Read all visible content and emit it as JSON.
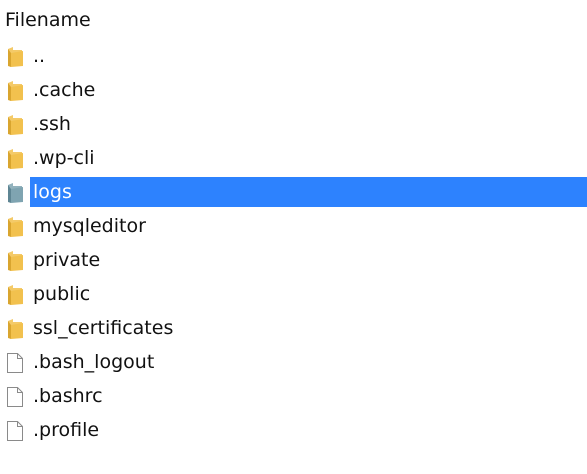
{
  "header": {
    "filename_label": "Filename"
  },
  "colors": {
    "selection": "#2d82fe",
    "folder": "#f2c14e",
    "folder_selected": "#7fa4b1",
    "file_outline": "#8a8a8a"
  },
  "files": [
    {
      "name": "..",
      "type": "folder",
      "icon": "folder-icon",
      "selected": false
    },
    {
      "name": ".cache",
      "type": "folder",
      "icon": "folder-icon",
      "selected": false
    },
    {
      "name": ".ssh",
      "type": "folder",
      "icon": "folder-icon",
      "selected": false
    },
    {
      "name": ".wp-cli",
      "type": "folder",
      "icon": "folder-icon",
      "selected": false
    },
    {
      "name": "logs",
      "type": "folder",
      "icon": "folder-icon",
      "selected": true
    },
    {
      "name": "mysqleditor",
      "type": "folder",
      "icon": "folder-icon",
      "selected": false
    },
    {
      "name": "private",
      "type": "folder",
      "icon": "folder-icon",
      "selected": false
    },
    {
      "name": "public",
      "type": "folder",
      "icon": "folder-icon",
      "selected": false
    },
    {
      "name": "ssl_certificates",
      "type": "folder",
      "icon": "folder-icon",
      "selected": false
    },
    {
      "name": ".bash_logout",
      "type": "file",
      "icon": "file-icon",
      "selected": false
    },
    {
      "name": ".bashrc",
      "type": "file",
      "icon": "file-icon",
      "selected": false
    },
    {
      "name": ".profile",
      "type": "file",
      "icon": "file-icon",
      "selected": false
    }
  ]
}
